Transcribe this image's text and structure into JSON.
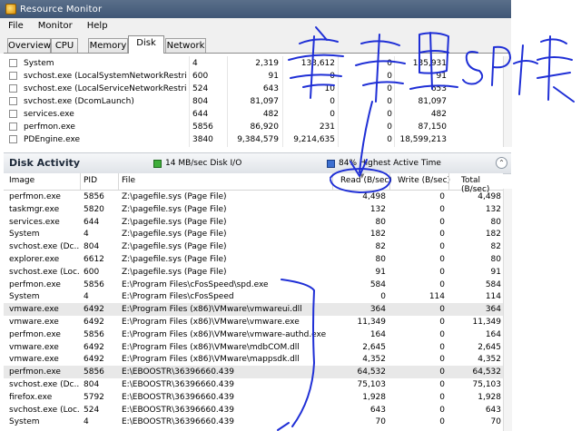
{
  "window": {
    "title": "Resource Monitor"
  },
  "menu": [
    "File",
    "Monitor",
    "Help"
  ],
  "tabs": [
    "Overview",
    "CPU",
    "Memory",
    "Disk",
    "Network"
  ],
  "processes": [
    {
      "name": "System",
      "pid": "4",
      "c1": "2,319",
      "c2": "133,612",
      "c3": "0",
      "c4": "135,931"
    },
    {
      "name": "svchost.exe (LocalSystemNetworkRestrict...",
      "pid": "600",
      "c1": "91",
      "c2": "0",
      "c3": "0",
      "c4": "91"
    },
    {
      "name": "svchost.exe (LocalServiceNetworkRestrict...",
      "pid": "524",
      "c1": "643",
      "c2": "10",
      "c3": "0",
      "c4": "653"
    },
    {
      "name": "svchost.exe (DcomLaunch)",
      "pid": "804",
      "c1": "81,097",
      "c2": "0",
      "c3": "0",
      "c4": "81,097"
    },
    {
      "name": "services.exe",
      "pid": "644",
      "c1": "482",
      "c2": "0",
      "c3": "0",
      "c4": "482"
    },
    {
      "name": "perfmon.exe",
      "pid": "5856",
      "c1": "86,920",
      "c2": "231",
      "c3": "0",
      "c4": "87,150"
    },
    {
      "name": "PDEngine.exe",
      "pid": "3840",
      "c1": "9,384,579",
      "c2": "9,214,635",
      "c3": "0",
      "c4": "18,599,213"
    }
  ],
  "disk_activity": {
    "title": "Disk Activity",
    "io_label": "14 MB/sec Disk I/O",
    "active_label": "84% Highest Active Time",
    "collapse_glyph": "⌃"
  },
  "disk_columns": [
    "Image",
    "PID",
    "File",
    "Read (B/sec)",
    "Write (B/sec)",
    "Total (B/sec)"
  ],
  "disk_rows": [
    {
      "image": "perfmon.exe",
      "pid": "5856",
      "file": "Z:\\pagefile.sys (Page File)",
      "read": "4,498",
      "write": "0",
      "total": "4,498"
    },
    {
      "image": "taskmgr.exe",
      "pid": "5820",
      "file": "Z:\\pagefile.sys (Page File)",
      "read": "132",
      "write": "0",
      "total": "132"
    },
    {
      "image": "services.exe",
      "pid": "644",
      "file": "Z:\\pagefile.sys (Page File)",
      "read": "80",
      "write": "0",
      "total": "80"
    },
    {
      "image": "System",
      "pid": "4",
      "file": "Z:\\pagefile.sys (Page File)",
      "read": "182",
      "write": "0",
      "total": "182"
    },
    {
      "image": "svchost.exe (Dc...",
      "pid": "804",
      "file": "Z:\\pagefile.sys (Page File)",
      "read": "82",
      "write": "0",
      "total": "82"
    },
    {
      "image": "explorer.exe",
      "pid": "6612",
      "file": "Z:\\pagefile.sys (Page File)",
      "read": "80",
      "write": "0",
      "total": "80"
    },
    {
      "image": "svchost.exe (Loc...",
      "pid": "600",
      "file": "Z:\\pagefile.sys (Page File)",
      "read": "91",
      "write": "0",
      "total": "91"
    },
    {
      "image": "perfmon.exe",
      "pid": "5856",
      "file": "E:\\Program Files\\cFosSpeed\\spd.exe",
      "read": "584",
      "write": "0",
      "total": "584"
    },
    {
      "image": "System",
      "pid": "4",
      "file": "E:\\Program Files\\cFosSpeed",
      "read": "0",
      "write": "114",
      "total": "114"
    },
    {
      "image": "vmware.exe",
      "pid": "6492",
      "file": "E:\\Program Files (x86)\\VMware\\vmwareui.dll",
      "read": "364",
      "write": "0",
      "total": "364",
      "hl": true
    },
    {
      "image": "vmware.exe",
      "pid": "6492",
      "file": "E:\\Program Files (x86)\\VMware\\vmware.exe",
      "read": "11,349",
      "write": "0",
      "total": "11,349"
    },
    {
      "image": "perfmon.exe",
      "pid": "5856",
      "file": "E:\\Program Files (x86)\\VMware\\vmware-authd.exe",
      "read": "164",
      "write": "0",
      "total": "164"
    },
    {
      "image": "vmware.exe",
      "pid": "6492",
      "file": "E:\\Program Files (x86)\\VMware\\mdbCOM.dll",
      "read": "2,645",
      "write": "0",
      "total": "2,645"
    },
    {
      "image": "vmware.exe",
      "pid": "6492",
      "file": "E:\\Program Files (x86)\\VMware\\mappsdk.dll",
      "read": "4,352",
      "write": "0",
      "total": "4,352"
    },
    {
      "image": "perfmon.exe",
      "pid": "5856",
      "file": "E:\\EBOOSTR\\36396660.439",
      "read": "64,532",
      "write": "0",
      "total": "64,532",
      "hl": true
    },
    {
      "image": "svchost.exe (Dc...",
      "pid": "804",
      "file": "E:\\EBOOSTR\\36396660.439",
      "read": "75,103",
      "write": "0",
      "total": "75,103"
    },
    {
      "image": "firefox.exe",
      "pid": "5792",
      "file": "E:\\EBOOSTR\\36396660.439",
      "read": "1,928",
      "write": "0",
      "total": "1,928"
    },
    {
      "image": "svchost.exe (Loc...",
      "pid": "524",
      "file": "E:\\EBOOSTR\\36396660.439",
      "read": "643",
      "write": "0",
      "total": "643"
    },
    {
      "image": "System",
      "pid": "4",
      "file": "E:\\EBOOSTR\\36396660.439",
      "read": "70",
      "write": "0",
      "total": "70"
    }
  ],
  "colors": {
    "ink": "#1f2fd6",
    "io_green": "#3fae3a",
    "active_blue": "#3c6fd0"
  }
}
